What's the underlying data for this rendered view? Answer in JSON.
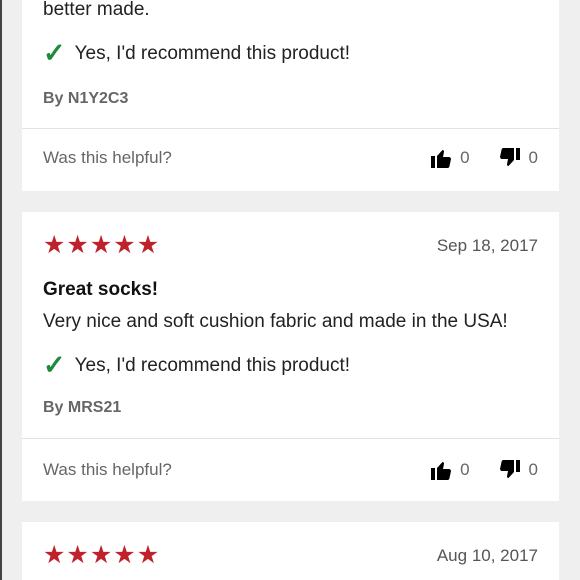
{
  "reviews": [
    {
      "text": "better made.",
      "recommend": "Yes, I'd recommend this product!",
      "author": "By N1Y2C3",
      "helpful_label": "Was this helpful?",
      "up_count": "0",
      "down_count": "0"
    },
    {
      "rating": 5,
      "date": "Sep 18, 2017",
      "title": "Great socks!",
      "text": "Very nice and soft cushion fabric and made in the USA!",
      "recommend": "Yes, I'd recommend this product!",
      "author": "By MRS21",
      "helpful_label": "Was this helpful?",
      "up_count": "0",
      "down_count": "0"
    },
    {
      "rating": 5,
      "date": "Aug 10, 2017"
    }
  ],
  "icons": {
    "star": "star-icon",
    "check": "checkmark-icon",
    "thumbs_up": "thumbs-up-icon",
    "thumbs_down": "thumbs-down-icon"
  },
  "colors": {
    "star": "#c0222c",
    "check": "#1f8a3a",
    "background": "#efefef"
  }
}
